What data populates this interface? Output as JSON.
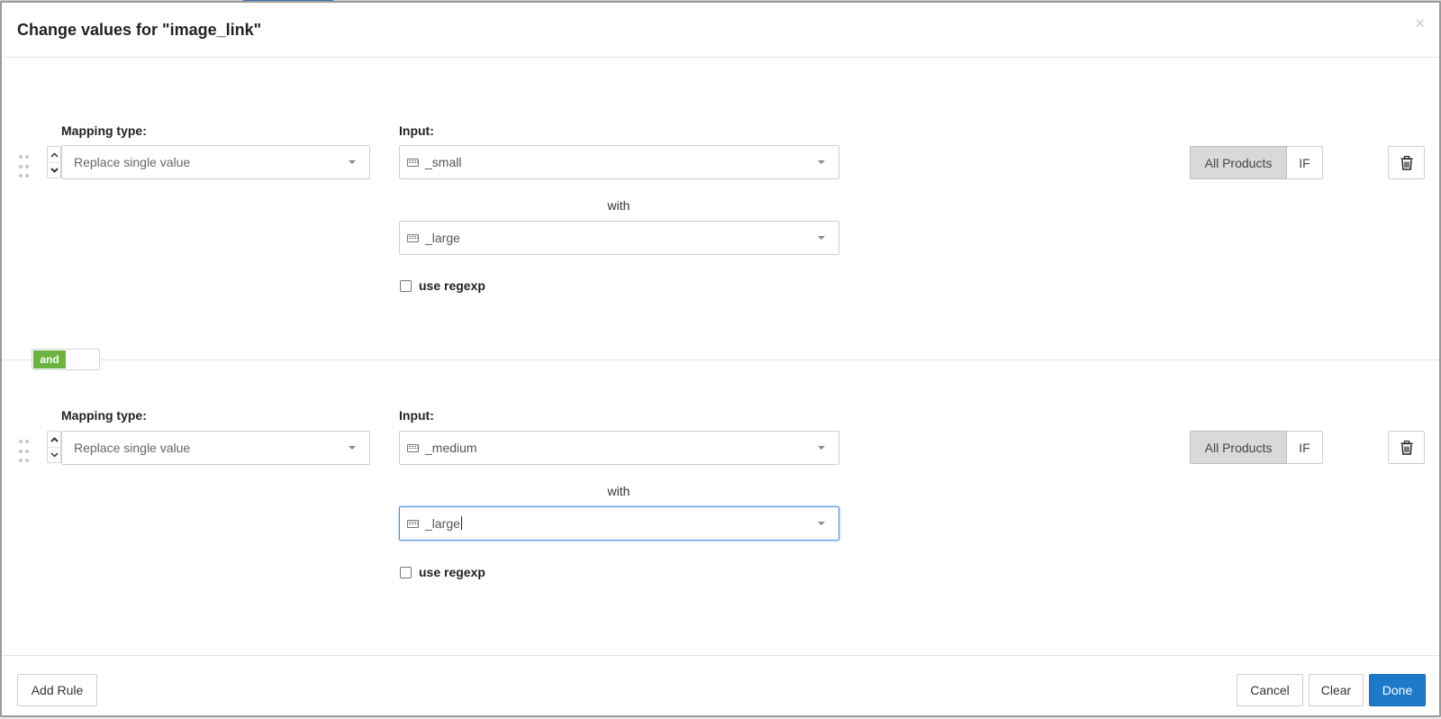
{
  "dialog": {
    "title": "Change values for \"image_link\"",
    "close_glyph": "×"
  },
  "rules": [
    {
      "mapping_type_label": "Mapping type:",
      "mapping_type_value": "Replace single value",
      "input_label": "Input:",
      "input_value": "_small",
      "with_label": "with",
      "with_value": "_large",
      "use_regexp_label": "use regexp",
      "use_regexp_checked": false,
      "scope_all_label": "All Products",
      "scope_if_label": "IF"
    },
    {
      "mapping_type_label": "Mapping type:",
      "mapping_type_value": "Replace single value",
      "input_label": "Input:",
      "input_value": "_medium",
      "with_label": "with",
      "with_value": "_large",
      "use_regexp_label": "use regexp",
      "use_regexp_checked": false,
      "scope_all_label": "All Products",
      "scope_if_label": "IF"
    }
  ],
  "connector": {
    "label": "and",
    "color": "#6db33f"
  },
  "footer": {
    "add_rule": "Add Rule",
    "cancel": "Cancel",
    "clear": "Clear",
    "done": "Done"
  },
  "colors": {
    "primary": "#1c7ac9",
    "focus": "#4a8ee6"
  }
}
